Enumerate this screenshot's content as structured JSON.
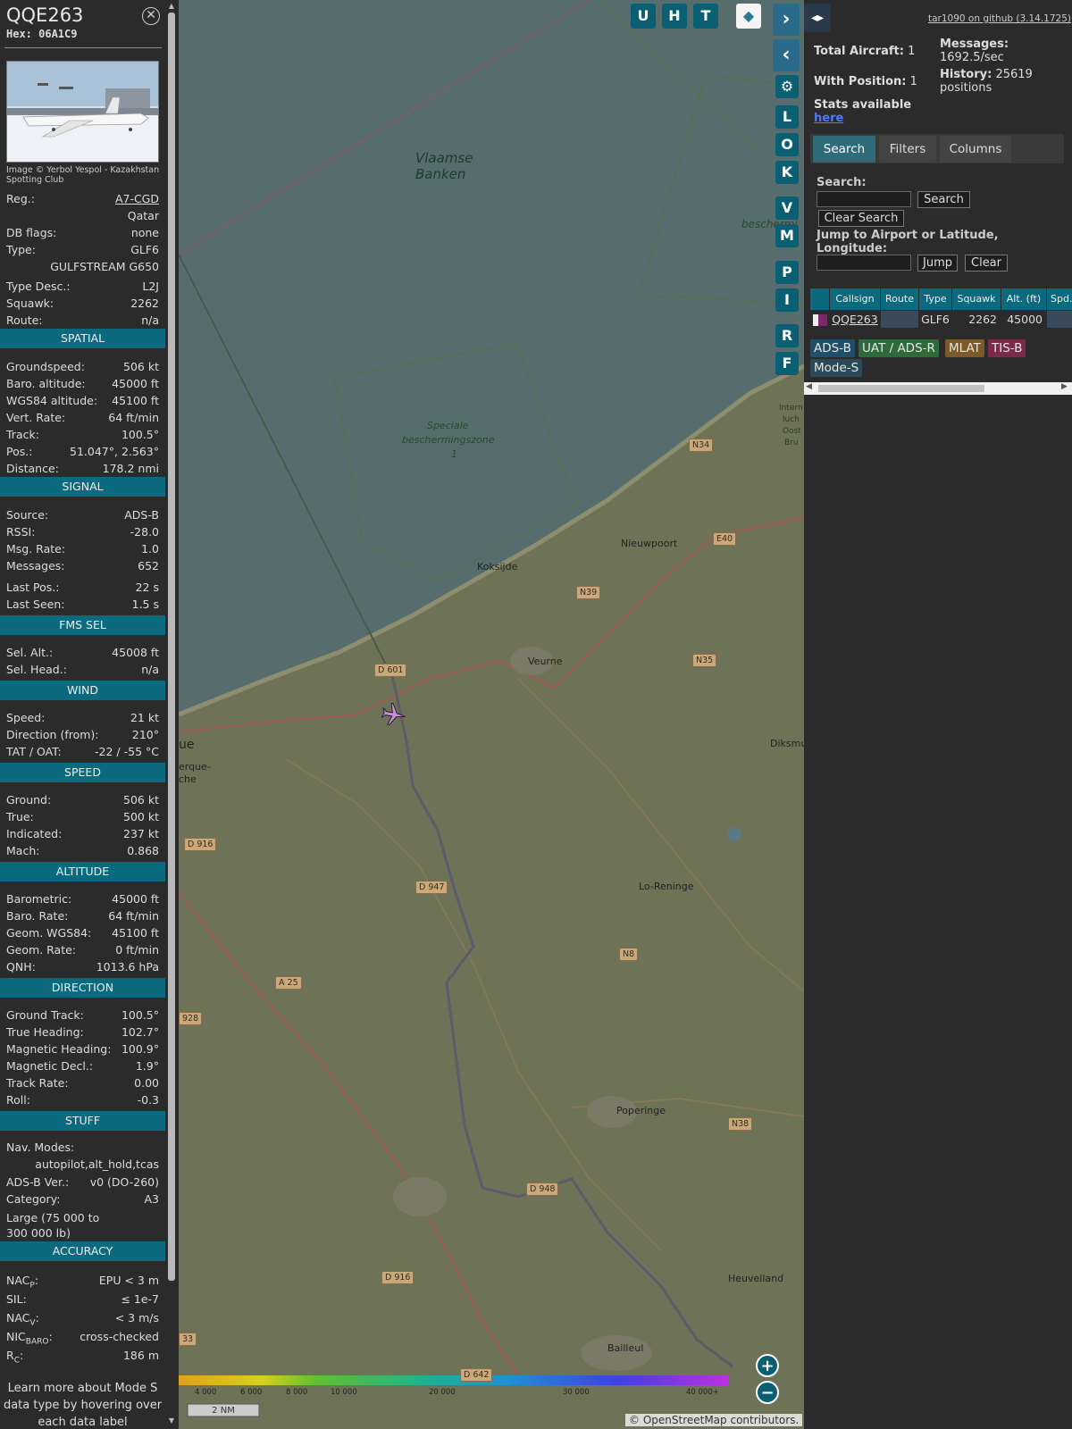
{
  "aircraft": {
    "callsign": "QQE263",
    "hex": "Hex: 06A1C9",
    "photo_credit": "Image © Yerbol Yespol - Kazakhstan Spotting Club"
  },
  "info": [
    {
      "k": "Reg.:",
      "v": "A7-CGD"
    },
    {
      "k": "",
      "v": "Qatar"
    },
    {
      "k": "DB flags:",
      "v": "none"
    },
    {
      "k": "Type:",
      "v": "GLF6"
    },
    {
      "k": "",
      "v": "GULFSTREAM G650"
    },
    {
      "k": "Type Desc.:",
      "v": "L2J"
    },
    {
      "k": "Squawk:",
      "v": "2262"
    },
    {
      "k": "Route:",
      "v": "n/a"
    }
  ],
  "sections": {
    "spatial": "SPATIAL",
    "signal": "SIGNAL",
    "fms": "FMS SEL",
    "wind": "WIND",
    "speed": "SPEED",
    "altitude": "ALTITUDE",
    "direction": "DIRECTION",
    "stuff": "STUFF",
    "accuracy": "ACCURACY"
  },
  "spatial": [
    {
      "k": "Groundspeed:",
      "v": "506 kt"
    },
    {
      "k": "Baro. altitude:",
      "v": "45000 ft"
    },
    {
      "k": "WGS84 altitude:",
      "v": "45100 ft"
    },
    {
      "k": "Vert. Rate:",
      "v": "64 ft/min"
    },
    {
      "k": "Track:",
      "v": "100.5°"
    },
    {
      "k": "Pos.:",
      "v": "51.047°, 2.563°"
    },
    {
      "k": "Distance:",
      "v": "178.2 nmi"
    }
  ],
  "signal": [
    {
      "k": "Source:",
      "v": "ADS-B"
    },
    {
      "k": "RSSI:",
      "v": "-28.0"
    },
    {
      "k": "Msg. Rate:",
      "v": "1.0"
    },
    {
      "k": "Messages:",
      "v": "652"
    },
    {
      "k": "Last Pos.:",
      "v": "22 s"
    },
    {
      "k": "Last Seen:",
      "v": "1.5 s"
    }
  ],
  "fms": [
    {
      "k": "Sel. Alt.:",
      "v": "45008 ft"
    },
    {
      "k": "Sel. Head.:",
      "v": "n/a"
    }
  ],
  "wind": [
    {
      "k": "Speed:",
      "v": "21 kt"
    },
    {
      "k": "Direction (from):",
      "v": "210°"
    },
    {
      "k": "TAT / OAT:",
      "v": "-22 / -55 °C"
    }
  ],
  "speed": [
    {
      "k": "Ground:",
      "v": "506 kt"
    },
    {
      "k": "True:",
      "v": "500 kt"
    },
    {
      "k": "Indicated:",
      "v": "237 kt"
    },
    {
      "k": "Mach:",
      "v": "0.868"
    }
  ],
  "altitude": [
    {
      "k": "Barometric:",
      "v": "45000 ft"
    },
    {
      "k": "Baro. Rate:",
      "v": "64 ft/min"
    },
    {
      "k": "Geom. WGS84:",
      "v": "45100 ft"
    },
    {
      "k": "Geom. Rate:",
      "v": "0 ft/min"
    },
    {
      "k": "QNH:",
      "v": "1013.6 hPa"
    }
  ],
  "direction": [
    {
      "k": "Ground Track:",
      "v": "100.5°"
    },
    {
      "k": "True Heading:",
      "v": "102.7°"
    },
    {
      "k": "Magnetic Heading:",
      "v": "100.9°"
    },
    {
      "k": "Magnetic Decl.:",
      "v": "1.9°"
    },
    {
      "k": "Track Rate:",
      "v": "0.00"
    },
    {
      "k": "Roll:",
      "v": "-0.3"
    }
  ],
  "stuff": {
    "nav_modes_label": "Nav. Modes:",
    "nav_modes_value": "autopilot,alt_hold,tcas",
    "adsb_ver_label": "ADS-B Ver.:",
    "adsb_ver_value": "v0 (DO-260)",
    "category_label": "Category:",
    "category_value": "A3",
    "category_desc": "Large (75 000 to 300 000 lb)"
  },
  "accuracy": [
    {
      "k": "NAC",
      "sub": "P",
      "v": "EPU < 3 m"
    },
    {
      "k": "SIL:",
      "sub": "",
      "v": "≤ 1e-7"
    },
    {
      "k": "NAC",
      "sub": "V",
      "v": "< 3 m/s"
    },
    {
      "k": "NIC",
      "sub": "BARO",
      "v": "cross-checked"
    },
    {
      "k": "R",
      "sub": "C",
      "v": "186 m"
    }
  ],
  "footer_note": "Learn more about Mode S data type by hovering over each data label",
  "map": {
    "buttons_top": [
      "U",
      "H",
      "T"
    ],
    "buttons_side": [
      "L",
      "O",
      "K",
      "V",
      "M",
      "P",
      "I",
      "R",
      "F"
    ],
    "labels": [
      {
        "t": "Vlaamse",
        "c": "sea"
      },
      {
        "t": "Banken",
        "c": "sea"
      },
      {
        "t": "Speciale",
        "c": "zone"
      },
      {
        "t": "beschermingszone",
        "c": "zone"
      },
      {
        "t": "1",
        "c": "zone"
      },
      {
        "t": "Nieuwpoort",
        "c": "town"
      },
      {
        "t": "Koksijde",
        "c": "town"
      },
      {
        "t": "Veurne",
        "c": "town"
      },
      {
        "t": "Lo-Reninge",
        "c": "town"
      },
      {
        "t": "Poperinge",
        "c": "town"
      },
      {
        "t": "Heuvelland",
        "c": "town"
      },
      {
        "t": "Bailleul",
        "c": "town"
      },
      {
        "t": "Diksmu",
        "c": "town"
      },
      {
        "t": "beschermi",
        "c": "zone"
      },
      {
        "t": "Intern",
        "c": "town"
      },
      {
        "t": "luch",
        "c": "town"
      },
      {
        "t": "Oost",
        "c": "town"
      },
      {
        "t": "Bru",
        "c": "town"
      },
      {
        "t": "ue",
        "c": "town"
      },
      {
        "t": "erque-",
        "c": "town"
      },
      {
        "t": "che",
        "c": "town"
      }
    ],
    "roads": [
      "N34",
      "N39",
      "N35",
      "D 601",
      "E40",
      "D 916",
      "D 947",
      "N8",
      "A 25",
      "928",
      "N38",
      "D 948",
      "D 916",
      "D 642",
      "33"
    ],
    "scale_label": "2 NM",
    "altitude_ticks": [
      "4 000",
      "6 000",
      "8 000",
      "10 000",
      "20 000",
      "30 000",
      "40 000+"
    ],
    "attribution": "© OpenStreetMap contributors."
  },
  "panel": {
    "github_link": "tar1090 on github (3.14.1725)",
    "total_aircraft_label": "Total Aircraft:",
    "total_aircraft_value": "1",
    "with_position_label": "With Position:",
    "with_position_value": "1",
    "messages_label": "Messages:",
    "messages_value": "1692.5/sec",
    "history_label": "History:",
    "history_value": "25619",
    "history_unit": "positions",
    "stats_label": "Stats available",
    "stats_link": "here",
    "tabs": [
      "Search",
      "Filters",
      "Columns"
    ],
    "search_label": "Search:",
    "search_button": "Search",
    "clear_search_button": "Clear Search",
    "jump_label": "Jump to Airport or Latitude, Longitude:",
    "jump_button": "Jump",
    "clear_button": "Clear",
    "table_headers": [
      "Callsign",
      "Route",
      "Type",
      "Squawk",
      "Alt. (ft)",
      "Spd."
    ],
    "table_row": {
      "callsign": "QQE263",
      "route": "",
      "type": "GLF6",
      "squawk": "2262",
      "alt": "45000"
    },
    "legend": [
      {
        "t": "ADS-B",
        "bg": "#1f4f6a",
        "fg": "#e6e6e6"
      },
      {
        "t": "UAT / ADS-R",
        "bg": "#2f6a3a",
        "fg": "#e6e6e6"
      },
      {
        "t": "MLAT",
        "bg": "#7a5a2a",
        "fg": "#e6e6e6"
      },
      {
        "t": "TIS-B",
        "bg": "#7a2a4a",
        "fg": "#e6e6e6"
      },
      {
        "t": "Mode-S",
        "bg": "#2a4a5a",
        "fg": "#e6e6e6"
      }
    ]
  }
}
